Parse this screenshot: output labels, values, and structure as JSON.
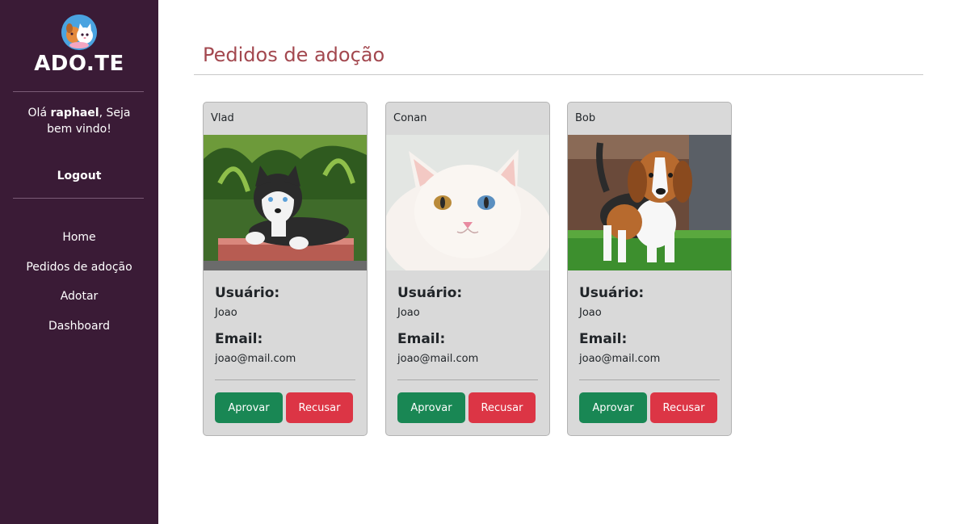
{
  "sidebar": {
    "brand": "ADO.TE",
    "greeting_prefix": "Olá ",
    "username": "raphael",
    "greeting_suffix": ", Seja bem vindo!",
    "logout_label": "Logout",
    "nav": [
      "Home",
      "Pedidos de adoção",
      "Adotar",
      "Dashboard"
    ]
  },
  "main": {
    "title": "Pedidos de adoção",
    "requests": [
      {
        "pet_name": "Vlad",
        "user_label": "Usuário:",
        "user": "Joao",
        "email_label": "Email:",
        "email": "joao@mail.com",
        "approve_label": "Aprovar",
        "refuse_label": "Recusar",
        "photo": "husky-puppy-photo"
      },
      {
        "pet_name": "Conan",
        "user_label": "Usuário:",
        "user": "Joao",
        "email_label": "Email:",
        "email": "joao@mail.com",
        "approve_label": "Aprovar",
        "refuse_label": "Recusar",
        "photo": "white-cat-photo"
      },
      {
        "pet_name": "Bob",
        "user_label": "Usuário:",
        "user": "Joao",
        "email_label": "Email:",
        "email": "joao@mail.com",
        "approve_label": "Aprovar",
        "refuse_label": "Recusar",
        "photo": "beagle-puppy-photo"
      }
    ]
  },
  "colors": {
    "sidebar_bg": "#3a1b36",
    "title": "#a3484f",
    "approve": "#198754",
    "refuse": "#dc3545",
    "card_bg": "#d9d9d9"
  }
}
